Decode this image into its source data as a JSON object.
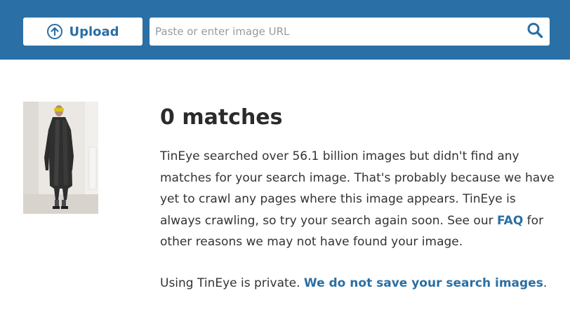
{
  "header": {
    "upload_label": "Upload",
    "search_placeholder": "Paste or enter image URL",
    "search_value": ""
  },
  "results": {
    "heading": "0 matches",
    "para1_a": "TinEye searched over 56.1 billion images but didn't find any matches for your search image. That's probably because we have yet to crawl any pages where this image appears. TinEye is always crawling, so try your search again soon. See our ",
    "faq_link": "FAQ",
    "para1_b": " for other reasons we may not have found your image.",
    "para2_a": "Using TinEye is private. ",
    "privacy_link": "We do not save your search images",
    "para2_b": "."
  },
  "colors": {
    "header_bg": "#2a6fa5",
    "link": "#2a6fa5",
    "text": "#333333"
  },
  "icons": {
    "upload": "arrow-up-circle-icon",
    "search": "search-icon"
  }
}
